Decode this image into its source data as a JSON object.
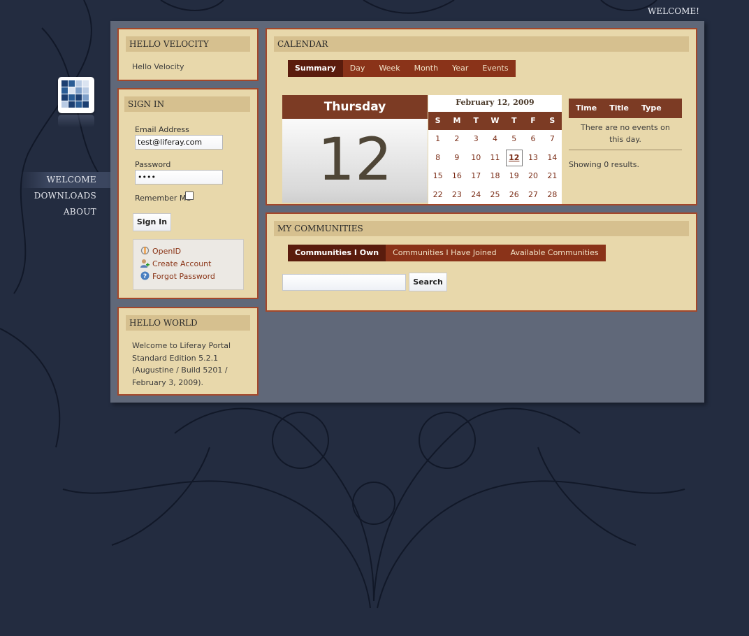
{
  "header": {
    "welcome_text": "WELCOME!"
  },
  "sidebar": {
    "items": [
      {
        "label": "WELCOME",
        "active": true
      },
      {
        "label": "DOWNLOADS",
        "active": false
      },
      {
        "label": "ABOUT",
        "active": false
      }
    ]
  },
  "hello_velocity": {
    "title": "HELLO VELOCITY",
    "body": "Hello Velocity"
  },
  "sign_in": {
    "title": "SIGN IN",
    "email_label": "Email Address",
    "email_value": "test@liferay.com",
    "password_label": "Password",
    "password_value": "••••",
    "remember_label": "Remember Me",
    "button_label": "Sign In",
    "links": [
      {
        "label": "OpenID",
        "icon": "openid-icon"
      },
      {
        "label": "Create Account",
        "icon": "add-user-icon"
      },
      {
        "label": "Forgot Password",
        "icon": "help-icon"
      }
    ]
  },
  "hello_world": {
    "title": "HELLO WORLD",
    "lines": [
      "Welcome to Liferay Portal",
      "Standard Edition 5.2.1",
      "(Augustine / Build 5201 /",
      "February 3, 2009)."
    ]
  },
  "calendar": {
    "title": "CALENDAR",
    "tabs": [
      "Summary",
      "Day",
      "Week",
      "Month",
      "Year",
      "Events"
    ],
    "active_tab": "Summary",
    "day_name": "Thursday",
    "day_number": "12",
    "mini_title": "February 12, 2009",
    "dow": [
      "S",
      "M",
      "T",
      "W",
      "T",
      "F",
      "S"
    ],
    "weeks": [
      [
        "1",
        "2",
        "3",
        "4",
        "5",
        "6",
        "7"
      ],
      [
        "8",
        "9",
        "10",
        "11",
        "12",
        "13",
        "14"
      ],
      [
        "15",
        "16",
        "17",
        "18",
        "19",
        "20",
        "21"
      ],
      [
        "22",
        "23",
        "24",
        "25",
        "26",
        "27",
        "28"
      ]
    ],
    "today": "12",
    "events_columns": [
      "Time",
      "Title",
      "Type"
    ],
    "no_events": "There are no events on this day.",
    "showing": "Showing 0 results."
  },
  "communities": {
    "title": "MY COMMUNITIES",
    "tabs": [
      "Communities I Own",
      "Communities I Have Joined",
      "Available Communities"
    ],
    "active_tab": "Communities I Own",
    "search_value": "",
    "search_button": "Search"
  },
  "colors": {
    "background": "#232c40",
    "portlet": "#e8d8ab",
    "portlet_border": "#a4472a",
    "tab_bar": "#8a3319",
    "tab_active": "#5a1c0d"
  }
}
